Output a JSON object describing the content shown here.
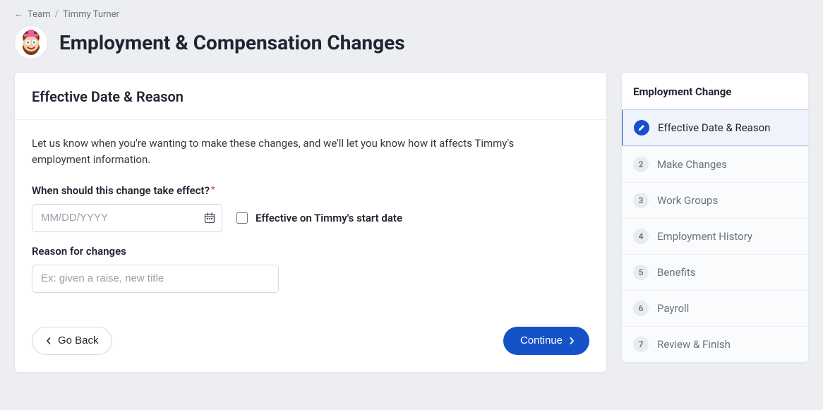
{
  "breadcrumb": {
    "back_arrow": "←",
    "team": "Team",
    "sep": "/",
    "person": "Timmy Turner"
  },
  "header": {
    "title": "Employment & Compensation Changes"
  },
  "main": {
    "section_title": "Effective Date & Reason",
    "intro": "Let us know when you're wanting to make these changes, and we'll let you know how it affects Timmy's employment information.",
    "date_label": "When should this change take effect?",
    "date_placeholder": "MM/DD/YYYY",
    "start_date_checkbox_label": "Effective on Timmy's start date",
    "reason_label": "Reason for changes",
    "reason_placeholder": "Ex: given a raise, new title",
    "back_label": "Go Back",
    "continue_label": "Continue"
  },
  "side": {
    "title": "Employment Change",
    "steps": [
      {
        "num": "",
        "label": "Effective Date & Reason",
        "active": true
      },
      {
        "num": "2",
        "label": "Make Changes"
      },
      {
        "num": "3",
        "label": "Work Groups"
      },
      {
        "num": "4",
        "label": "Employment History"
      },
      {
        "num": "5",
        "label": "Benefits"
      },
      {
        "num": "6",
        "label": "Payroll"
      },
      {
        "num": "7",
        "label": "Review & Finish"
      }
    ]
  }
}
